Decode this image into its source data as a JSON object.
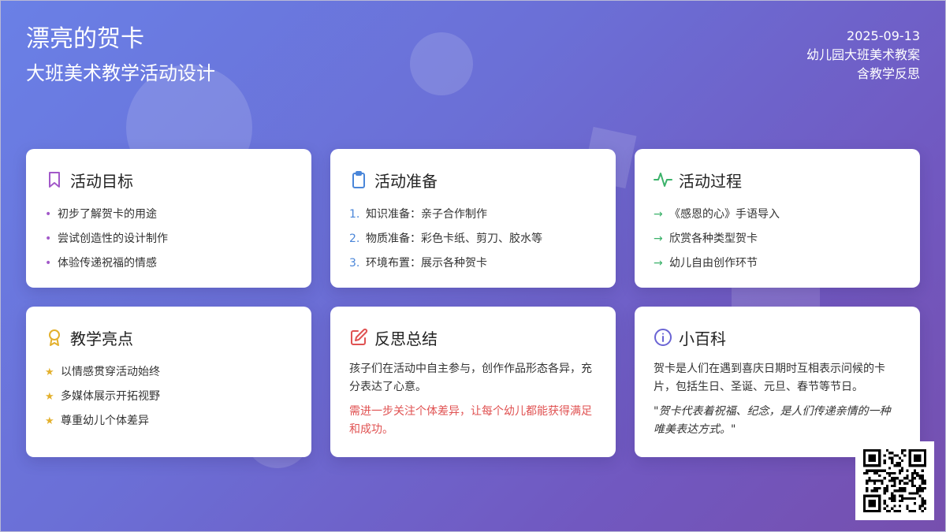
{
  "header": {
    "title": "漂亮的贺卡",
    "subtitle": "大班美术教学活动设计",
    "date": "2025-09-13",
    "meta_line1": "幼儿园大班美术教案",
    "meta_line2": "含教学反思"
  },
  "colors": {
    "goal": "#a259c9",
    "prep": "#4a86d9",
    "process": "#3bb26a",
    "highlight": "#e3b02c",
    "reflect": "#e05252",
    "encyclopedia": "#6a64d4"
  },
  "cards": {
    "goal": {
      "icon": "bookmark-icon",
      "title": "活动目标",
      "marker": "•",
      "items": [
        "初步了解贺卡的用途",
        "尝试创造性的设计制作",
        "体验传递祝福的情感"
      ]
    },
    "prep": {
      "icon": "clipboard-icon",
      "title": "活动准备",
      "items": [
        {
          "num": "1.",
          "text": "知识准备：亲子合作制作"
        },
        {
          "num": "2.",
          "text": "物质准备：彩色卡纸、剪刀、胶水等"
        },
        {
          "num": "3.",
          "text": "环境布置：展示各种贺卡"
        }
      ]
    },
    "process": {
      "icon": "activity-pulse-icon",
      "title": "活动过程",
      "marker": "→",
      "items": [
        "《感恩的心》手语导入",
        "欣赏各种类型贺卡",
        "幼儿自由创作环节"
      ]
    },
    "highlight": {
      "icon": "award-icon",
      "title": "教学亮点",
      "marker": "★",
      "items": [
        "以情感贯穿活动始终",
        "多媒体展示开拓视野",
        "尊重幼儿个体差异"
      ]
    },
    "reflect": {
      "icon": "edit-icon",
      "title": "反思总结",
      "text": "孩子们在活动中自主参与，创作作品形态各异，充分表达了心意。",
      "note": "需进一步关注个体差异，让每个幼儿都能获得满足和成功。"
    },
    "encyclopedia": {
      "icon": "info-icon",
      "title": "小百科",
      "text": "贺卡是人们在遇到喜庆日期时互相表示问候的卡片，包括生日、圣诞、元旦、春节等节日。",
      "quote": "\"贺卡代表着祝福、纪念，是人们传递亲情的一种唯美表达方式。\""
    }
  },
  "qr_code": {
    "icon": "qr-code-icon"
  }
}
